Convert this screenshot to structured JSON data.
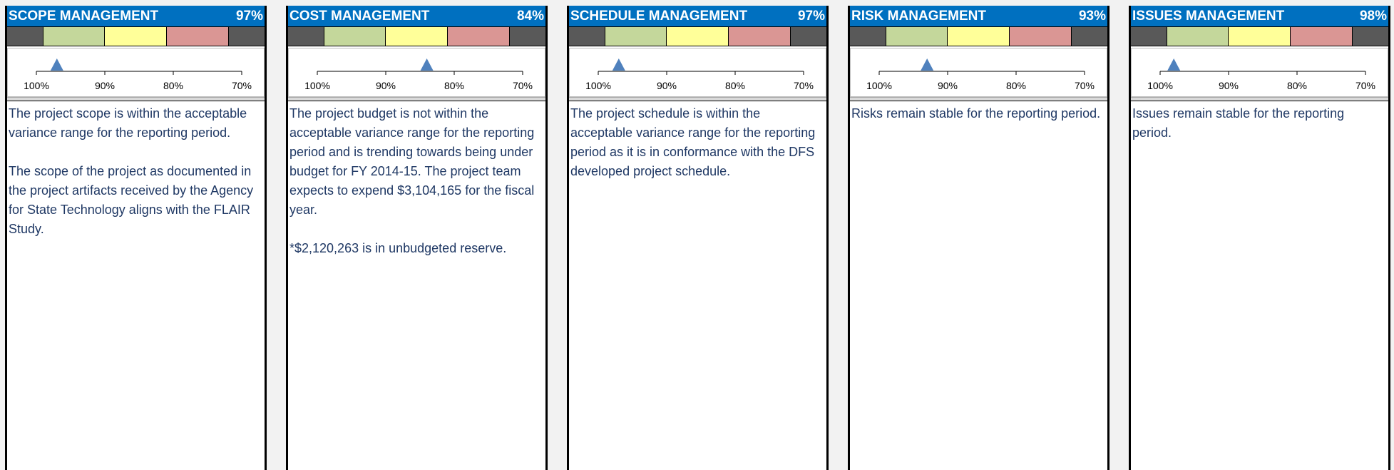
{
  "scale_labels": [
    "100%",
    "90%",
    "80%",
    "70%"
  ],
  "panels": [
    {
      "title": "SCOPE MANAGEMENT",
      "percent": "97%",
      "indicator_value": 0.97,
      "paragraphs": [
        "The project scope is within the acceptable variance range for the reporting period.",
        "The scope of the project as documented in the project artifacts received by the Agency for State Technology aligns with the FLAIR Study."
      ]
    },
    {
      "title": "COST MANAGEMENT",
      "percent": "84%",
      "indicator_value": 0.84,
      "paragraphs": [
        "The project budget is not within the acceptable variance range for the reporting period and is trending towards being under budget for FY 2014-15. The project team expects to expend $3,104,165 for the fiscal year.",
        "*$2,120,263 is in unbudgeted reserve."
      ]
    },
    {
      "title": "SCHEDULE MANAGEMENT",
      "percent": "97%",
      "indicator_value": 0.97,
      "paragraphs": [
        "The project schedule is within the acceptable variance range for the reporting period as it is in conformance with the DFS developed project schedule."
      ]
    },
    {
      "title": "RISK MANAGEMENT",
      "percent": "93%",
      "indicator_value": 0.93,
      "paragraphs": [
        "Risks remain stable for the reporting period."
      ]
    },
    {
      "title": "ISSUES MANAGEMENT",
      "percent": "98%",
      "indicator_value": 0.98,
      "paragraphs": [
        "Issues remain stable for the reporting period."
      ]
    }
  ],
  "colors": {
    "header_bg": "#0070c0",
    "green_band": "#c4d79b",
    "yellow_band": "#ffff99",
    "red_band": "#da9694",
    "marker": "#4f81bd",
    "text": "#1f3864"
  }
}
